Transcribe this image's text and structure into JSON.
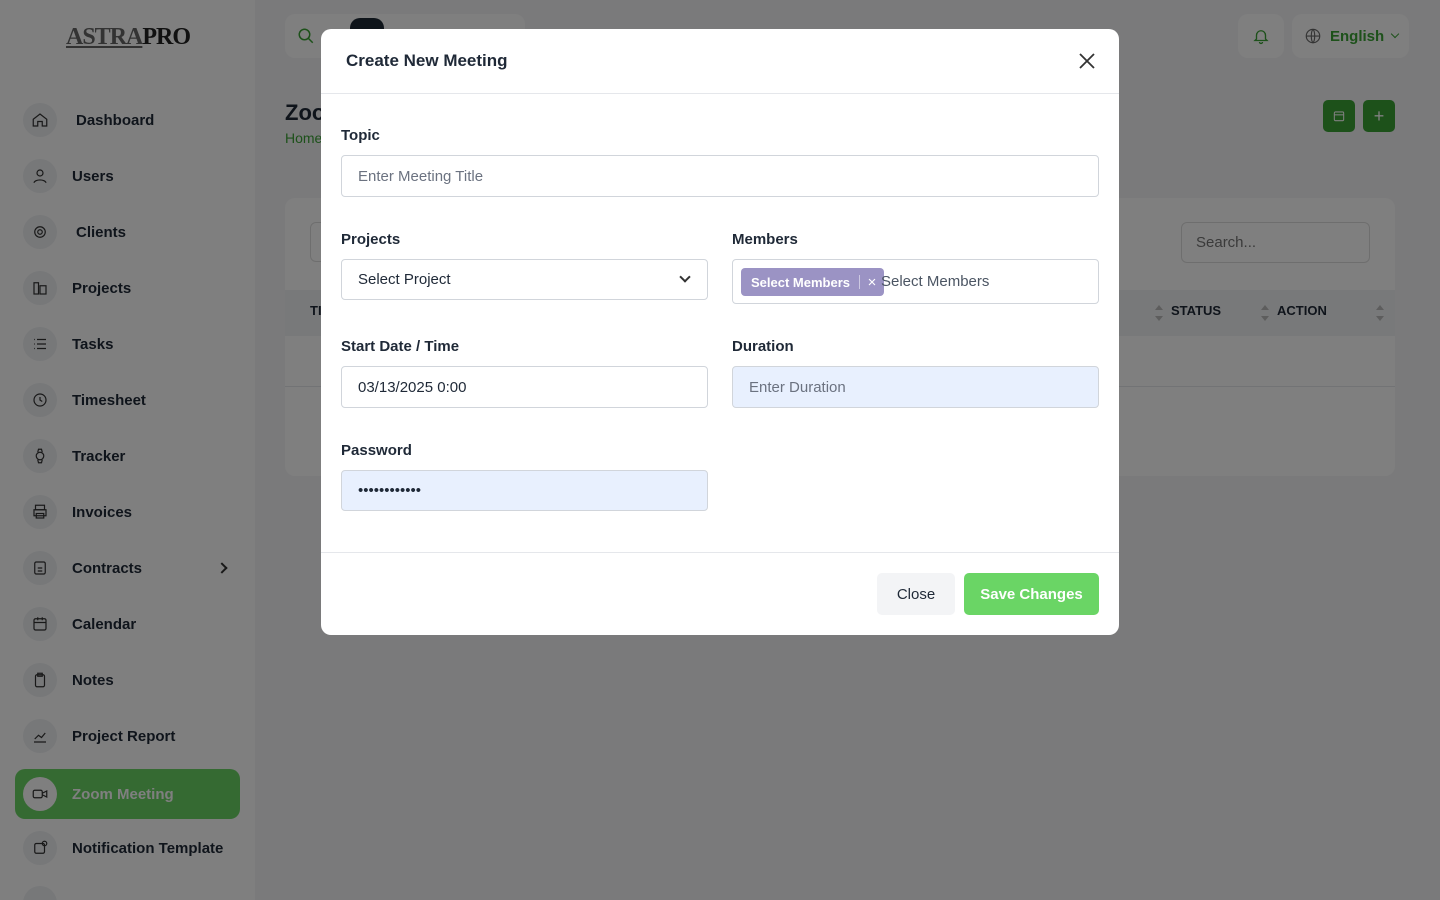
{
  "app": {
    "logo_prefix": "ASTRA",
    "logo_suffix": "PRO"
  },
  "sidebar": {
    "items": [
      {
        "label": "Dashboard",
        "icon": "home-icon"
      },
      {
        "label": "Users",
        "icon": "user-icon"
      },
      {
        "label": "Clients",
        "icon": "clients-icon"
      },
      {
        "label": "Projects",
        "icon": "projects-icon"
      },
      {
        "label": "Tasks",
        "icon": "list-icon"
      },
      {
        "label": "Timesheet",
        "icon": "clock-icon"
      },
      {
        "label": "Tracker",
        "icon": "watch-icon"
      },
      {
        "label": "Invoices",
        "icon": "printer-icon"
      },
      {
        "label": "Contracts",
        "icon": "contract-icon"
      },
      {
        "label": "Calendar",
        "icon": "calendar-icon"
      },
      {
        "label": "Notes",
        "icon": "clipboard-icon"
      },
      {
        "label": "Project Report",
        "icon": "chart-icon"
      },
      {
        "label": "Zoom Meeting",
        "icon": "video-icon",
        "active": true
      },
      {
        "label": "Notification Template",
        "icon": "notification-icon"
      }
    ]
  },
  "topbar": {
    "language": "English"
  },
  "page": {
    "title": "Zoom Meeting",
    "breadcrumb": "Home",
    "search_placeholder": "Search...",
    "columns": [
      "TITLE",
      "STATUS",
      "ACTION"
    ]
  },
  "modal": {
    "title": "Create New Meeting",
    "topic": {
      "label": "Topic",
      "placeholder": "Enter Meeting Title"
    },
    "projects": {
      "label": "Projects",
      "value": "Select Project"
    },
    "members": {
      "label": "Members",
      "chip": "Select Members",
      "placeholder": "Select Members"
    },
    "start": {
      "label": "Start Date / Time",
      "value": "03/13/2025 0:00"
    },
    "duration": {
      "label": "Duration",
      "placeholder": "Enter Duration"
    },
    "password": {
      "label": "Password",
      "value": "••••••••••••"
    },
    "close_label": "Close",
    "save_label": "Save Changes"
  },
  "colors": {
    "accent": "#6ad565",
    "accent_dark": "#3aa335",
    "chip": "#9b93c4"
  }
}
